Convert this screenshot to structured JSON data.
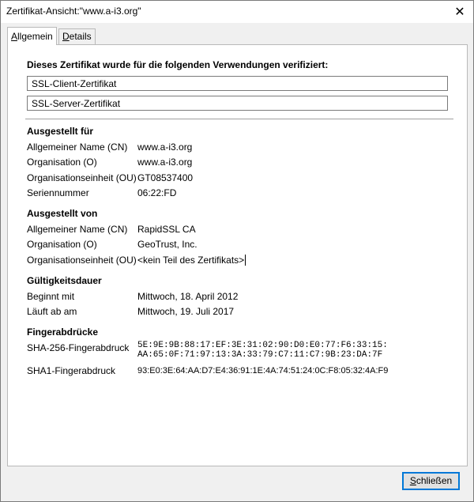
{
  "window": {
    "title": "Zertifikat-Ansicht:\"www.a-i3.org\"",
    "close_glyph": "✕"
  },
  "tabs": [
    {
      "access_key": "A",
      "rest": "llgemein"
    },
    {
      "access_key": "D",
      "rest": "etails"
    }
  ],
  "general": {
    "usage_heading": "Dieses Zertifikat wurde für die folgenden Verwendungen verifiziert:",
    "usages": [
      "SSL-Client-Zertifikat",
      "SSL-Server-Zertifikat"
    ],
    "issued_to": {
      "heading": "Ausgestellt für",
      "rows": [
        {
          "label": "Allgemeiner Name (CN)",
          "value": "www.a-i3.org"
        },
        {
          "label": "Organisation (O)",
          "value": "www.a-i3.org"
        },
        {
          "label": "Organisationseinheit (OU)",
          "value": "GT08537400"
        },
        {
          "label": "Seriennummer",
          "value": "06:22:FD"
        }
      ]
    },
    "issued_by": {
      "heading": "Ausgestellt von",
      "rows": [
        {
          "label": "Allgemeiner Name (CN)",
          "value": "RapidSSL CA"
        },
        {
          "label": "Organisation (O)",
          "value": "GeoTrust, Inc."
        },
        {
          "label": "Organisationseinheit (OU)",
          "value": "<kein Teil des Zertifikats>"
        }
      ]
    },
    "validity": {
      "heading": "Gültigkeitsdauer",
      "rows": [
        {
          "label": "Beginnt mit",
          "value": "Mittwoch, 18. April 2012"
        },
        {
          "label": "Läuft ab am",
          "value": "Mittwoch, 19. Juli 2017"
        }
      ]
    },
    "fingerprints": {
      "heading": "Fingerabdrücke",
      "sha256_label": "SHA-256-Fingerabdruck",
      "sha256_line1": "5E:9E:9B:88:17:EF:3E:31:02:90:D0:E0:77:F6:33:15:",
      "sha256_line2": "AA:65:0F:71:97:13:3A:33:79:C7:11:C7:9B:23:DA:7F",
      "sha1_label": "SHA1-Fingerabdruck",
      "sha1_value": "93:E0:3E:64:AA:D7:E4:36:91:1E:4A:74:51:24:0C:F8:05:32:4A:F9"
    }
  },
  "footer": {
    "close_access_key": "S",
    "close_rest": "chließen"
  }
}
